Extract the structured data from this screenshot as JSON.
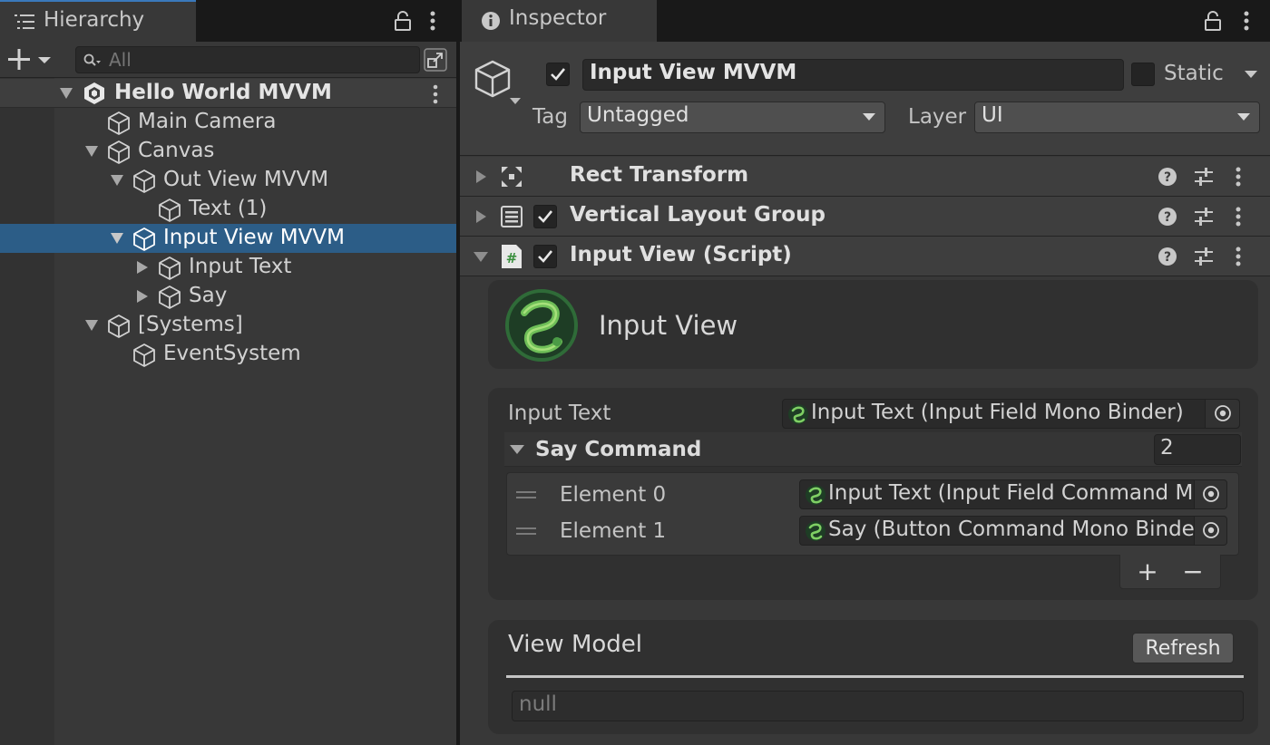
{
  "hierarchy": {
    "tab_label": "Hierarchy",
    "search_placeholder": "All",
    "root": {
      "label": "Hello World MVVM"
    },
    "items": [
      {
        "label": "Main Camera"
      },
      {
        "label": "Canvas"
      },
      {
        "label": "Out View MVVM"
      },
      {
        "label": "Text (1)"
      },
      {
        "label": "Input View MVVM"
      },
      {
        "label": "Input Text"
      },
      {
        "label": "Say"
      },
      {
        "label": "[Systems]"
      },
      {
        "label": "EventSystem"
      }
    ],
    "selected_item": "Input View MVVM"
  },
  "inspector": {
    "tab_label": "Inspector",
    "object_name": "Input View MVVM",
    "static_label": "Static",
    "tag_label": "Tag",
    "tag_value": "Untagged",
    "layer_label": "Layer",
    "layer_value": "UI",
    "components": [
      {
        "title": "Rect Transform"
      },
      {
        "title": "Vertical Layout Group"
      },
      {
        "title": "Input View (Script)"
      }
    ],
    "script_header": {
      "title": "Input View"
    },
    "properties": {
      "input_text_label": "Input Text",
      "input_text_value": "Input Text (Input Field Mono Binder)",
      "say_command_label": "Say Command",
      "say_command_count": "2",
      "elements": [
        {
          "label": "Element 0",
          "value": "Input Text (Input Field Command M"
        },
        {
          "label": "Element 1",
          "value": "Say (Button Command Mono Binder"
        }
      ],
      "add_label": "+",
      "remove_label": "−"
    },
    "view_model": {
      "title": "View Model",
      "refresh_label": "Refresh",
      "value": "null"
    }
  },
  "colors": {
    "selection": "#2c5d87",
    "panel": "#383838",
    "accent_blue": "#3a79bb",
    "script_icon_green": "#4caf50"
  }
}
